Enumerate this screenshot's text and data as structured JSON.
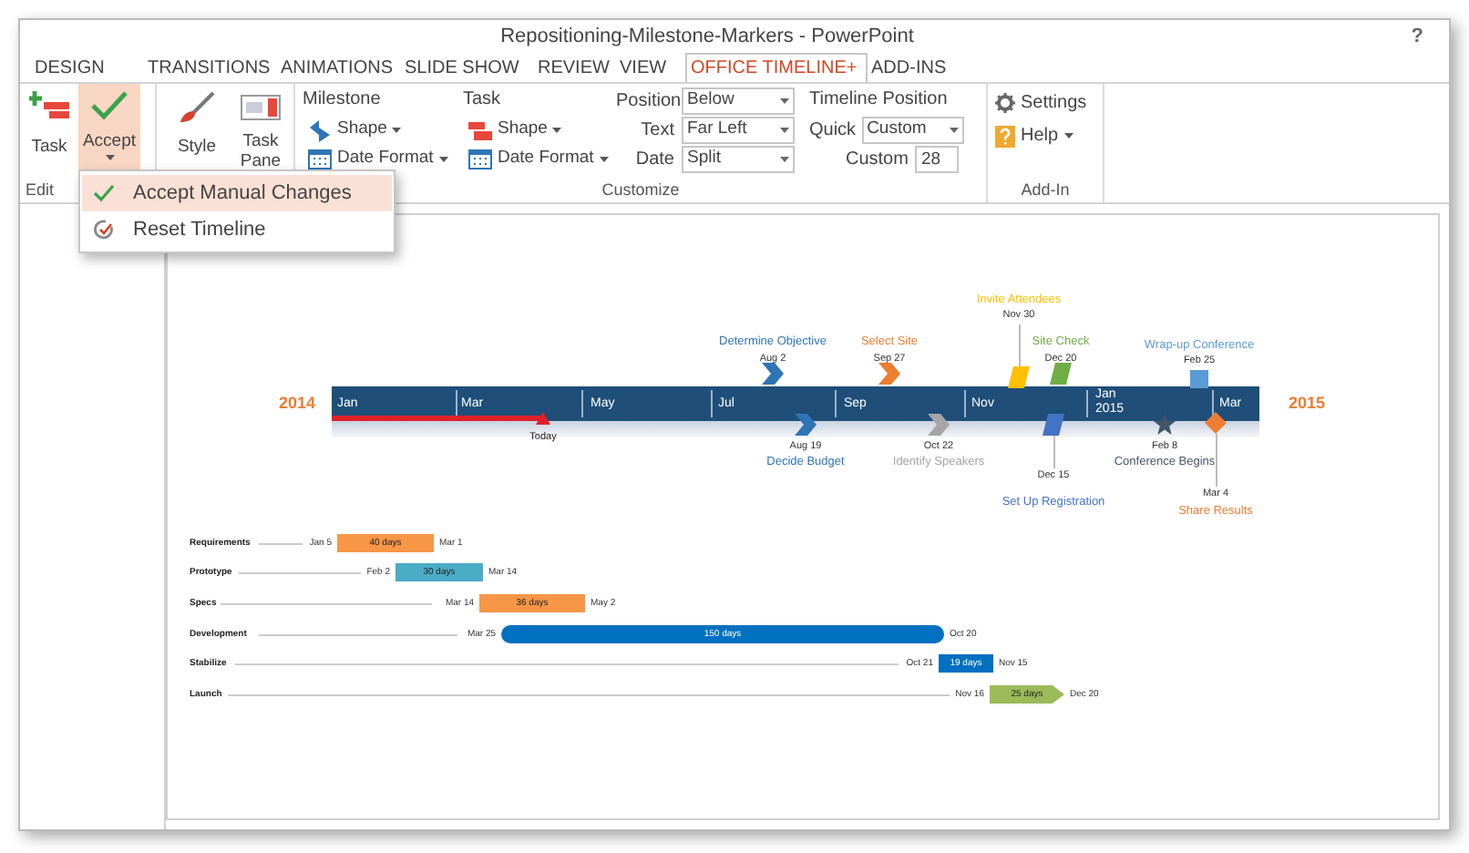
{
  "window": {
    "title": "Repositioning-Milestone-Markers - PowerPoint",
    "help": "?"
  },
  "tabs": [
    {
      "label": "DESIGN",
      "selected": false
    },
    {
      "label": "TRANSITIONS",
      "selected": false
    },
    {
      "label": "ANIMATIONS",
      "selected": false
    },
    {
      "label": "SLIDE SHOW",
      "selected": false
    },
    {
      "label": "REVIEW",
      "selected": false
    },
    {
      "label": "VIEW",
      "selected": false
    },
    {
      "label": "OFFICE TIMELINE+",
      "selected": true
    },
    {
      "label": "ADD-INS",
      "selected": false
    }
  ],
  "ribbon": {
    "edit": {
      "label": "Edit",
      "task_button": "Task",
      "accept_button": {
        "label": "Accept",
        "pressed": true
      }
    },
    "style_button": "Style",
    "task_pane_button": "Task Pane",
    "customize": {
      "label": "Customize",
      "milestone": {
        "heading": "Milestone",
        "shape": "Shape",
        "date_format": "Date Format"
      },
      "task": {
        "heading": "Task",
        "shape": "Shape",
        "date_format": "Date Format"
      },
      "fields": [
        {
          "label": "Position",
          "value": "Below"
        },
        {
          "label": "Text",
          "value": "Far Left"
        },
        {
          "label": "Date",
          "value": "Split"
        }
      ],
      "timeline_position": {
        "heading": "Timeline Position",
        "quick": {
          "label": "Quick",
          "value": "Custom"
        },
        "custom": {
          "label": "Custom",
          "value": "28"
        }
      }
    },
    "add_in": {
      "label": "Add-In",
      "settings": "Settings",
      "help": "Help"
    }
  },
  "dropdown_menu": [
    {
      "kind": "accept",
      "label": "Accept Manual Changes",
      "selected": true
    },
    {
      "kind": "reset",
      "label": "Reset Timeline",
      "selected": false
    }
  ],
  "timeline": {
    "start_year": "2014",
    "end_year": "2015",
    "today": "Today",
    "months": [
      {
        "label": "Jan"
      },
      {
        "label": "Mar"
      },
      {
        "label": "May"
      },
      {
        "label": "Jul"
      },
      {
        "label": "Sep"
      },
      {
        "label": "Nov"
      },
      {
        "label": "Jan",
        "year": "2015"
      },
      {
        "label": "Mar"
      }
    ],
    "milestones": [
      {
        "title": "Determine Objective",
        "date": "Aug 2",
        "kind": "chevron",
        "color": "#2e75b6"
      },
      {
        "title": "Select Site",
        "date": "Sep 27",
        "kind": "chevron",
        "color": "#ed7d31"
      },
      {
        "title": "Invite Attendees",
        "date": "Nov 30",
        "kind": "parallelogram",
        "color": "#ffc000"
      },
      {
        "title": "Site Check",
        "date": "Dec 20",
        "kind": "parallelogram",
        "color": "#70ad47"
      },
      {
        "title": "Wrap-up Conference",
        "date": "Feb 25",
        "kind": "square",
        "color": "#5b9bd5"
      },
      {
        "title": "Decide Budget",
        "date": "Aug 19",
        "kind": "chevron",
        "color": "#2e75b6"
      },
      {
        "title": "Identify Speakers",
        "date": "Oct 22",
        "kind": "chevron",
        "color": "#a5a5a5"
      },
      {
        "title": "Set Up Registration",
        "date": "Dec 15",
        "kind": "parallelogram",
        "color": "#4472c4"
      },
      {
        "title": "Conference Begins",
        "date": "Feb 8",
        "kind": "star",
        "color": "#44546a"
      },
      {
        "title": "Share Results",
        "date": "Mar 4",
        "kind": "diamond",
        "color": "#ed7d31"
      }
    ]
  },
  "tasks": [
    {
      "name": "Requirements",
      "start": "Jan 5",
      "end": "Mar 1",
      "duration": "40 days",
      "kind": "rect",
      "color": "#f79646"
    },
    {
      "name": "Prototype",
      "start": "Feb 2",
      "end": "Mar 14",
      "duration": "30 days",
      "kind": "rect",
      "color": "#4bacc6"
    },
    {
      "name": "Specs",
      "start": "Mar 14",
      "end": "May 2",
      "duration": "36 days",
      "kind": "rect",
      "color": "#f79646"
    },
    {
      "name": "Development",
      "start": "Mar 25",
      "end": "Oct 20",
      "duration": "150 days",
      "kind": "rounded",
      "color": "#0070c0"
    },
    {
      "name": "Stabilize",
      "start": "Oct 21",
      "end": "Nov 15",
      "duration": "19 days",
      "kind": "rect",
      "color": "#0070c0"
    },
    {
      "name": "Launch",
      "start": "Nov 16",
      "end": "Dec 20",
      "duration": "25 days",
      "kind": "arrow",
      "color": "#9bbb59"
    }
  ]
}
